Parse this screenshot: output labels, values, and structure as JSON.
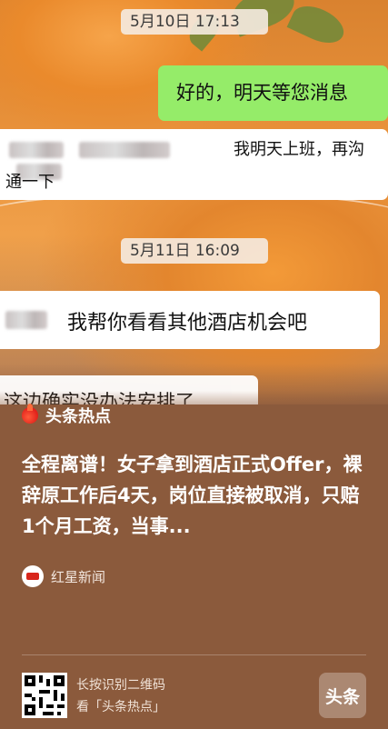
{
  "chat": {
    "timestamp_1": "5月10日 17:13",
    "msg_right_1": "好的，明天等您消息",
    "msg_left_1_line1": "我明天上班，再沟",
    "msg_left_1_line2": "通一下",
    "timestamp_2": "5月11日 16:09",
    "msg_left_2": "我帮你看看其他酒店机会吧",
    "msg_left_3": "这边确实没办法安排了"
  },
  "card": {
    "brand": "头条热点",
    "headline": "全程离谱！女子拿到酒店正式Offer，裸辞原工作后4天，岗位直接被取消，只赔1个月工资，当事...",
    "source": "红星新闻",
    "qr_line1": "长按识别二维码",
    "qr_line2": "看「头条热点」",
    "app_logo": "头条"
  },
  "colors": {
    "bubble_green": "#95ec69",
    "card_bg": "#8b5a3c"
  }
}
